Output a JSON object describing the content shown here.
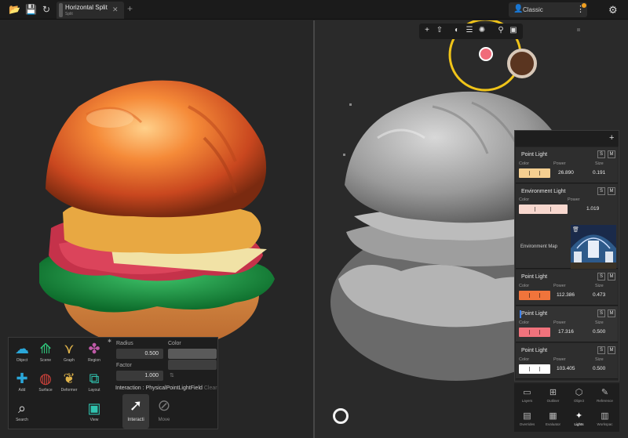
{
  "topbar": {
    "tab": {
      "title": "Horizontal Split",
      "subtitle": "Split"
    },
    "profile": "Classic"
  },
  "palette": {
    "tools": [
      "Object",
      "Scene",
      "Graph",
      "Region",
      "Add",
      "Surface",
      "Deformer",
      "Layout",
      "Search",
      "View"
    ],
    "props": {
      "radius_label": "Radius",
      "radius_value": "0.500",
      "color_label": "Color",
      "factor_label": "Factor",
      "factor_value": "1.000",
      "interaction": "Interaction : PhysicalPointLightField",
      "interaction_clear": "Clear"
    },
    "modes": [
      "Interacti",
      "Move"
    ]
  },
  "lights": {
    "solo_label": "S",
    "mute_label": "M",
    "items": [
      {
        "title": "Point Light",
        "color_label": "Color",
        "power_label": "Power",
        "power": "26.890",
        "size_label": "Size",
        "size": "0.191",
        "color": "#f5cf91"
      },
      {
        "title": "Environment Light",
        "color_label": "Color",
        "power_label": "Power",
        "power": "1.019",
        "map_label": "Environment Map",
        "color": "#f8d8cf"
      },
      {
        "title": "Point Light",
        "color_label": "Color",
        "power_label": "Power",
        "power": "112.386",
        "size_label": "Size",
        "size": "0.473",
        "color": "#f0743b"
      },
      {
        "title": "Point Light",
        "color_label": "Color",
        "power_label": "Power",
        "power": "17.316",
        "size_label": "Size",
        "size": "0.500",
        "color": "#f0727c"
      },
      {
        "title": "Point Light",
        "color_label": "Color",
        "power_label": "Power",
        "power": "103.405",
        "size_label": "Size",
        "size": "0.500",
        "color": "#ffffff"
      }
    ]
  },
  "nav": [
    "Layers",
    "Outliner",
    "Object",
    "Reference",
    "Overrides",
    "Evaluator",
    "Lights",
    "Workspac"
  ],
  "colors": {
    "accent": "#f0c419",
    "gizmo_pink": "#f06b7a",
    "selected": "#3b82f6"
  }
}
